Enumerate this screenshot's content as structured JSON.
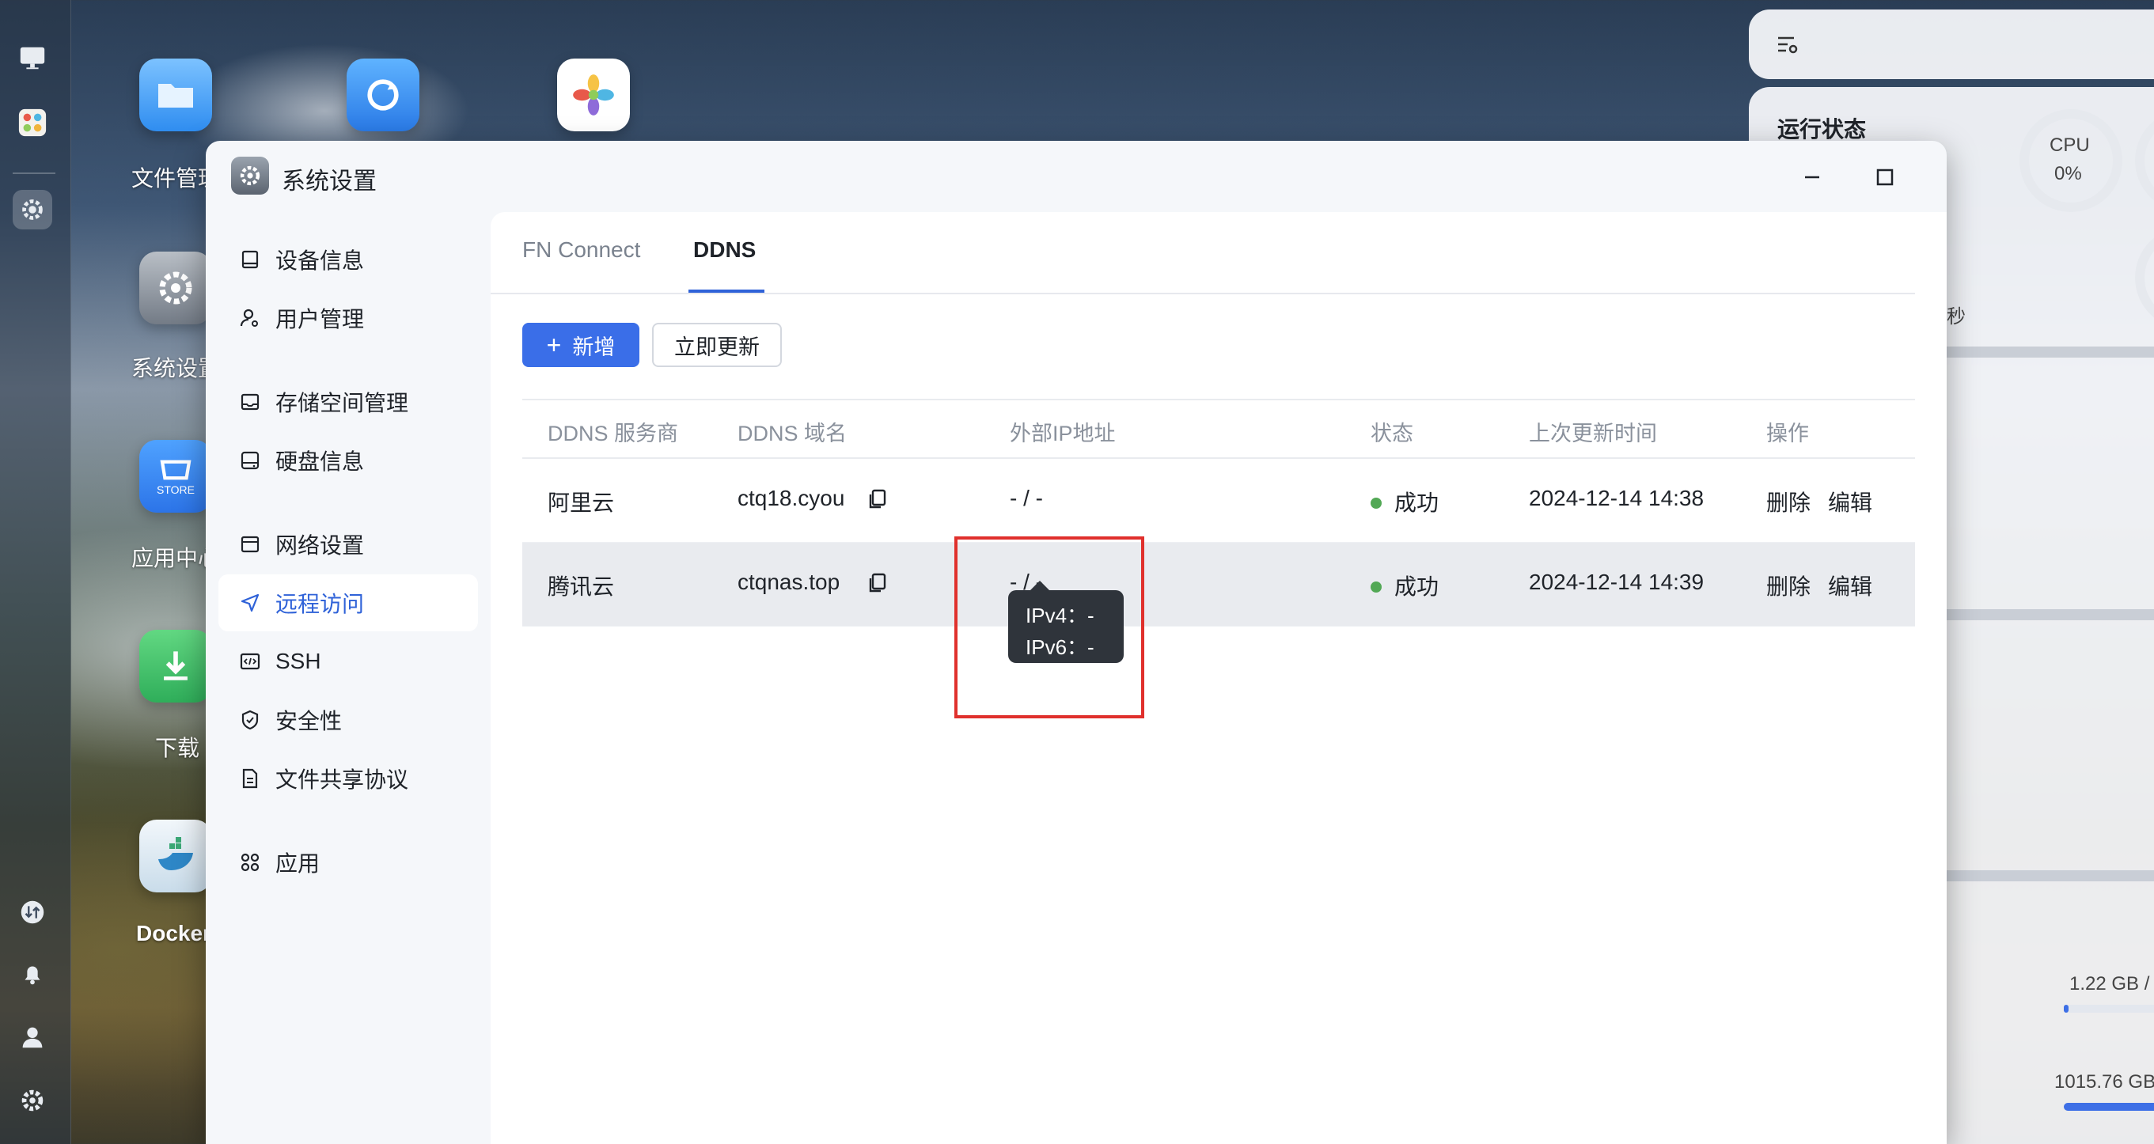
{
  "desktop": {
    "icons": [
      {
        "label": "文件管理",
        "icon": "folder-icon"
      },
      {
        "label": "",
        "icon": "sync-icon"
      },
      {
        "label": "",
        "icon": "photos-icon"
      },
      {
        "label": "系统设置",
        "icon": "settings-gear-icon"
      },
      {
        "label": "应用中心",
        "icon": "store-icon",
        "badge": "STORE"
      },
      {
        "label": "下载",
        "icon": "download-icon"
      },
      {
        "label": "Docker",
        "icon": "docker-icon"
      }
    ]
  },
  "widgets": {
    "status_title": "运行状态",
    "cpu_label": "CPU",
    "cpu_value": "0%",
    "partial_text": "秒",
    "storage1": "1.22 GB /",
    "storage2": "1015.76 GB"
  },
  "window": {
    "title": "系统设置",
    "controls": {
      "minimize": "minimize-icon",
      "maximize": "maximize-icon",
      "close": "close-icon"
    }
  },
  "sidebar": {
    "items": [
      {
        "label": "设备信息",
        "icon": "device-icon",
        "active": false
      },
      {
        "label": "用户管理",
        "icon": "user-icon",
        "active": false
      },
      {
        "label": "存储空间管理",
        "icon": "storage-icon",
        "active": false
      },
      {
        "label": "硬盘信息",
        "icon": "disk-icon",
        "active": false
      },
      {
        "label": "网络设置",
        "icon": "network-icon",
        "active": false
      },
      {
        "label": "远程访问",
        "icon": "send-icon",
        "active": true
      },
      {
        "label": "SSH",
        "icon": "code-icon",
        "active": false
      },
      {
        "label": "安全性",
        "icon": "shield-icon",
        "active": false
      },
      {
        "label": "文件共享协议",
        "icon": "document-icon",
        "active": false
      },
      {
        "label": "应用",
        "icon": "apps-icon",
        "active": false
      }
    ]
  },
  "tabs": [
    {
      "label": "FN Connect",
      "active": false
    },
    {
      "label": "DDNS",
      "active": true
    }
  ],
  "toolbar": {
    "add_label": "新增",
    "update_label": "立即更新"
  },
  "table": {
    "headers": [
      "DDNS 服务商",
      "DDNS 域名",
      "外部IP地址",
      "状态",
      "上次更新时间",
      "操作"
    ],
    "rows": [
      {
        "provider": "阿里云",
        "domain": "ctq18.cyou",
        "ip": "- / -",
        "status": "成功",
        "updated": "2024-12-14 14:38",
        "delete": "删除",
        "edit": "编辑"
      },
      {
        "provider": "腾讯云",
        "domain": "ctqnas.top",
        "ip": "- / -",
        "status": "成功",
        "updated": "2024-12-14 14:39",
        "delete": "删除",
        "edit": "编辑"
      }
    ]
  },
  "tooltip": {
    "ipv4": "IPv4：-",
    "ipv6": "IPv6：-"
  },
  "colors": {
    "accent": "#3a6ee8",
    "success": "#52a855",
    "highlight": "#e0302c"
  }
}
